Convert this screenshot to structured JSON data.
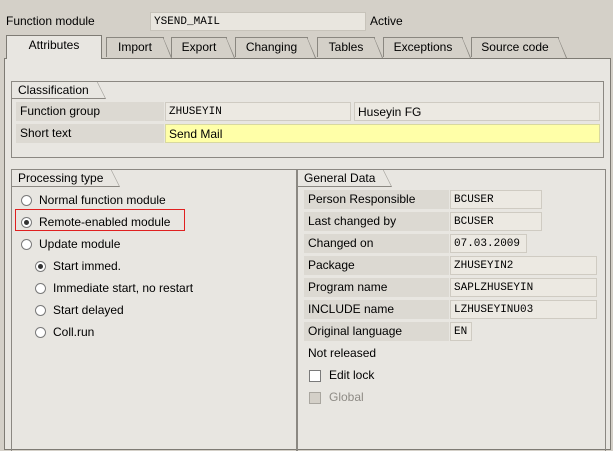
{
  "header": {
    "fm_label": "Function module",
    "fm_value": "YSEND_MAIL",
    "status": "Active"
  },
  "tabs": [
    {
      "label": "Attributes",
      "active": true
    },
    {
      "label": "Import"
    },
    {
      "label": "Export"
    },
    {
      "label": "Changing"
    },
    {
      "label": "Tables"
    },
    {
      "label": "Exceptions"
    },
    {
      "label": "Source code"
    }
  ],
  "classification": {
    "title": "Classification",
    "function_group_label": "Function group",
    "function_group_value": "ZHUSEYIN",
    "function_group_desc": "Huseyin FG",
    "short_text_label": "Short text",
    "short_text_value": "Send Mail"
  },
  "processing": {
    "title": "Processing type",
    "options": [
      {
        "label": "Normal function module",
        "selected": false
      },
      {
        "label": "Remote-enabled module",
        "selected": true
      },
      {
        "label": "Update module",
        "selected": false
      }
    ],
    "update_options": [
      {
        "label": "Start immed.",
        "selected": true
      },
      {
        "label": "Immediate start, no restart",
        "selected": false
      },
      {
        "label": "Start delayed",
        "selected": false
      },
      {
        "label": "Coll.run",
        "selected": false
      }
    ]
  },
  "general": {
    "title": "General Data",
    "fields": [
      {
        "label": "Person Responsible",
        "value": "BCUSER"
      },
      {
        "label": "Last changed by",
        "value": "BCUSER"
      },
      {
        "label": "Changed on",
        "value": "07.03.2009"
      },
      {
        "label": "Package",
        "value": "ZHUSEYIN2"
      },
      {
        "label": "Program name",
        "value": "SAPLZHUSEYIN"
      },
      {
        "label": "INCLUDE name",
        "value": "LZHUSEYINU03"
      },
      {
        "label": "Original language",
        "value": "EN"
      }
    ],
    "not_released": "Not released",
    "edit_lock": "Edit lock",
    "global": "Global"
  },
  "colors": {
    "highlight": "#e02020",
    "short_text_bg": "#ffffa8"
  }
}
